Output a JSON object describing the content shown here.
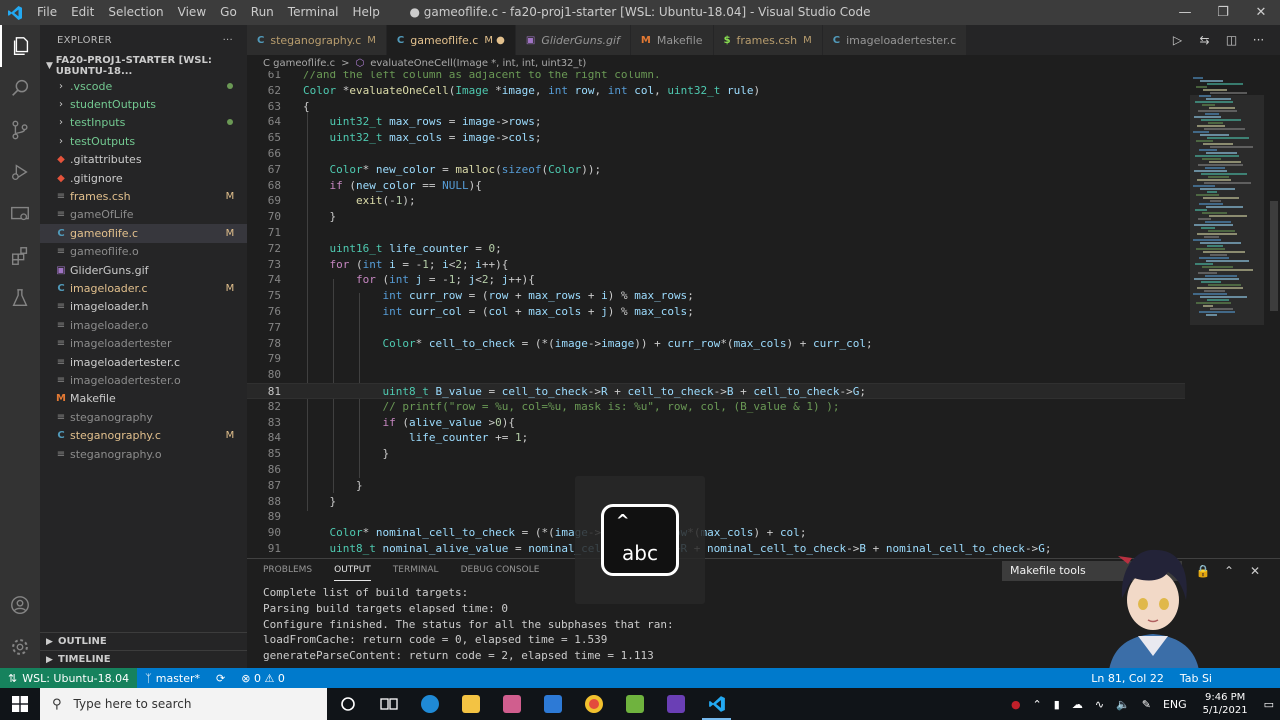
{
  "window": {
    "title": "● gameoflife.c - fa20-proj1-starter [WSL: Ubuntu-18.04] - Visual Studio Code",
    "menu": [
      "File",
      "Edit",
      "Selection",
      "View",
      "Go",
      "Run",
      "Terminal",
      "Help"
    ]
  },
  "sidebar": {
    "header": "EXPLORER",
    "header_more": "···",
    "folder": "FA20-PROJ1-STARTER [WSL: UBUNTU-18...",
    "items": [
      {
        "label": ".vscode",
        "kind": "folder",
        "badge": "dot"
      },
      {
        "label": "studentOutputs",
        "kind": "folder",
        "badge": ""
      },
      {
        "label": "testInputs",
        "kind": "folder",
        "badge": "dot"
      },
      {
        "label": "testOutputs",
        "kind": "folder",
        "badge": ""
      },
      {
        "label": ".gitattributes",
        "kind": "git",
        "badge": ""
      },
      {
        "label": ".gitignore",
        "kind": "git",
        "badge": ""
      },
      {
        "label": "frames.csh",
        "kind": "file",
        "badge": "M"
      },
      {
        "label": "gameOfLife",
        "kind": "file",
        "badge": ""
      },
      {
        "label": "gameoflife.c",
        "kind": "c",
        "badge": "M"
      },
      {
        "label": "gameoflife.o",
        "kind": "file",
        "badge": ""
      },
      {
        "label": "GliderGuns.gif",
        "kind": "image",
        "badge": ""
      },
      {
        "label": "imageloader.c",
        "kind": "c",
        "badge": "M"
      },
      {
        "label": "imageloader.h",
        "kind": "file",
        "badge": ""
      },
      {
        "label": "imageloader.o",
        "kind": "file",
        "badge": ""
      },
      {
        "label": "imageloadertester",
        "kind": "file",
        "badge": ""
      },
      {
        "label": "imageloadertester.c",
        "kind": "file",
        "badge": ""
      },
      {
        "label": "imageloadertester.o",
        "kind": "file",
        "badge": ""
      },
      {
        "label": "Makefile",
        "kind": "make",
        "badge": ""
      },
      {
        "label": "steganography",
        "kind": "file",
        "badge": ""
      },
      {
        "label": "steganography.c",
        "kind": "c",
        "badge": "M"
      },
      {
        "label": "steganography.o",
        "kind": "file",
        "badge": ""
      }
    ],
    "outline": "OUTLINE",
    "timeline": "TIMELINE"
  },
  "tabs": [
    {
      "icon": "C",
      "label": "steganography.c",
      "status": "M",
      "active": false,
      "italic": false
    },
    {
      "icon": "C",
      "label": "gameoflife.c",
      "status": "M ●",
      "active": true,
      "italic": false
    },
    {
      "icon": "▣",
      "label": "GliderGuns.gif",
      "status": "",
      "active": false,
      "italic": true
    },
    {
      "icon": "M",
      "label": "Makefile",
      "status": "",
      "active": false,
      "italic": false
    },
    {
      "icon": "$",
      "label": "frames.csh",
      "status": "M",
      "active": false,
      "italic": false
    },
    {
      "icon": "C",
      "label": "imageloadertester.c",
      "status": "",
      "active": false,
      "italic": false
    }
  ],
  "breadcrumb": {
    "file": "C gameoflife.c",
    "sep": ">",
    "symbol": "evaluateOneCell(Image *, int, int, uint32_t)"
  },
  "editor": {
    "current_line": 81,
    "lines": [
      {
        "n": "61",
        "html": "<span class=\"cm\">//and the left column as adjacent to the right column.</span>"
      },
      {
        "n": "62",
        "html": "<span class=\"ty\">Color</span> *<span class=\"fn\">evaluateOneCell</span>(<span class=\"ty\">Image</span> *<span class=\"var\">image</span>, <span class=\"kw\">int</span> <span class=\"var\">row</span>, <span class=\"kw\">int</span> <span class=\"var\">col</span>, <span class=\"ty\">uint32_t</span> <span class=\"var\">rule</span>)"
      },
      {
        "n": "63",
        "html": "{"
      },
      {
        "n": "64",
        "html": "    <span class=\"ty\">uint32_t</span> <span class=\"var\">max_rows</span> = <span class=\"var\">image</span>-><span class=\"var\">rows</span>;"
      },
      {
        "n": "65",
        "html": "    <span class=\"ty\">uint32_t</span> <span class=\"var\">max_cols</span> = <span class=\"var\">image</span>-><span class=\"var\">cols</span>;"
      },
      {
        "n": "66",
        "html": ""
      },
      {
        "n": "67",
        "html": "    <span class=\"ty\">Color</span>* <span class=\"var\">new_color</span> = <span class=\"fn\">malloc</span>(<span class=\"kw\">sizeof</span>(<span class=\"ty\">Color</span>));"
      },
      {
        "n": "68",
        "html": "    <span class=\"ctl\">if</span> (<span class=\"var\">new_color</span> == <span class=\"mac\">NULL</span>){"
      },
      {
        "n": "69",
        "html": "        <span class=\"fn\">exit</span>(-<span class=\"num\">1</span>);"
      },
      {
        "n": "70",
        "html": "    }"
      },
      {
        "n": "71",
        "html": ""
      },
      {
        "n": "72",
        "html": "    <span class=\"ty\">uint16_t</span> <span class=\"var\">life_counter</span> = <span class=\"num\">0</span>;"
      },
      {
        "n": "73",
        "html": "    <span class=\"ctl\">for</span> (<span class=\"kw\">int</span> <span class=\"var\">i</span> = -<span class=\"num\">1</span>; <span class=\"var\">i</span>&lt;<span class=\"num\">2</span>; <span class=\"var\">i</span>++){"
      },
      {
        "n": "74",
        "html": "        <span class=\"ctl\">for</span> (<span class=\"kw\">int</span> <span class=\"var\">j</span> = -<span class=\"num\">1</span>; <span class=\"var\">j</span>&lt;<span class=\"num\">2</span>; <span class=\"var\">j</span>++){"
      },
      {
        "n": "75",
        "html": "            <span class=\"kw\">int</span> <span class=\"var\">curr_row</span> = (<span class=\"var\">row</span> + <span class=\"var\">max_rows</span> + <span class=\"var\">i</span>) % <span class=\"var\">max_rows</span>;"
      },
      {
        "n": "76",
        "html": "            <span class=\"kw\">int</span> <span class=\"var\">curr_col</span> = (<span class=\"var\">col</span> + <span class=\"var\">max_cols</span> + <span class=\"var\">j</span>) % <span class=\"var\">max_cols</span>;"
      },
      {
        "n": "77",
        "html": ""
      },
      {
        "n": "78",
        "html": "            <span class=\"ty\">Color</span>* <span class=\"var\">cell_to_check</span> = (*(<span class=\"var\">image</span>-><span class=\"var\">image</span>)) + <span class=\"var\">curr_row</span>*(<span class=\"var\">max_cols</span>) + <span class=\"var\">curr_col</span>;"
      },
      {
        "n": "79",
        "html": ""
      },
      {
        "n": "80",
        "html": ""
      },
      {
        "n": "81",
        "html": "            <span class=\"ty\">uint8_t</span> <span class=\"var\">B_value</span> = <span class=\"var\">cell_to_check</span>-><span class=\"var\">R</span> + <span class=\"var\">cell_to_check</span>-><span class=\"var\">B</span> + <span class=\"var\">cell_to_check</span>-><span class=\"var\">G</span>;"
      },
      {
        "n": "82",
        "html": "            <span class=\"cm\">// printf(\"row = %u, col=%u, mask is: %u\", row, col, (B_value &amp; 1) );</span>"
      },
      {
        "n": "83",
        "html": "            <span class=\"ctl\">if</span> (<span class=\"var\">alive_value</span> &gt;<span class=\"num\">0</span>){"
      },
      {
        "n": "84",
        "html": "                <span class=\"var\">life_counter</span> += <span class=\"num\">1</span>;"
      },
      {
        "n": "85",
        "html": "            }"
      },
      {
        "n": "86",
        "html": ""
      },
      {
        "n": "87",
        "html": "        }"
      },
      {
        "n": "88",
        "html": "    }"
      },
      {
        "n": "89",
        "html": ""
      },
      {
        "n": "90",
        "html": "    <span class=\"ty\">Color</span>* <span class=\"var\">nominal_cell_to_check</span> = (*(<span class=\"var\">image</span>-><span class=\"var\">image</span>)) + <span class=\"var\">row</span>*(<span class=\"var\">max_cols</span>) + <span class=\"var\">col</span>;"
      },
      {
        "n": "91",
        "html": "    <span class=\"ty\">uint8_t</span> <span class=\"var\">nominal_alive_value</span> = <span class=\"var\">nominal_cell_to_check</span>-><span class=\"var\">R</span> + <span class=\"var\">nominal_cell_to_check</span>-><span class=\"var\">B</span> + <span class=\"var\">nominal_cell_to_check</span>-><span class=\"var\">G</span>;"
      }
    ]
  },
  "panel": {
    "tabs": [
      "PROBLEMS",
      "OUTPUT",
      "TERMINAL",
      "DEBUG CONSOLE"
    ],
    "active_tab": "OUTPUT",
    "channel": "Makefile tools",
    "output": [
      "Complete list of build targets:",
      "Parsing build targets elapsed time: 0",
      "Configure finished. The status for all the subphases that ran:",
      "loadFromCache: return code = 0, elapsed time = 1.539",
      "generateParseContent: return code = 2, elapsed time = 1.113"
    ]
  },
  "keyboard_overlay": {
    "text": "abc",
    "caret": "^"
  },
  "statusbar": {
    "remote": "WSL: Ubuntu-18.04",
    "branch": "master*",
    "sync": "⟳",
    "problems": "⊗ 0 ⚠ 0",
    "position": "Ln 81, Col 22",
    "tabsize": "Tab Si"
  },
  "taskbar": {
    "search_placeholder": "Type here to search",
    "lang": "ENG",
    "time": "9:46 PM",
    "date": "5/1/2021"
  },
  "colors": {
    "statusbar": "#007acc",
    "remote": "#16825d",
    "keyword": "#569cd6",
    "type": "#4ec9b0",
    "function": "#dcdcaa",
    "variable": "#9cdcfe",
    "comment": "#6a9955"
  }
}
